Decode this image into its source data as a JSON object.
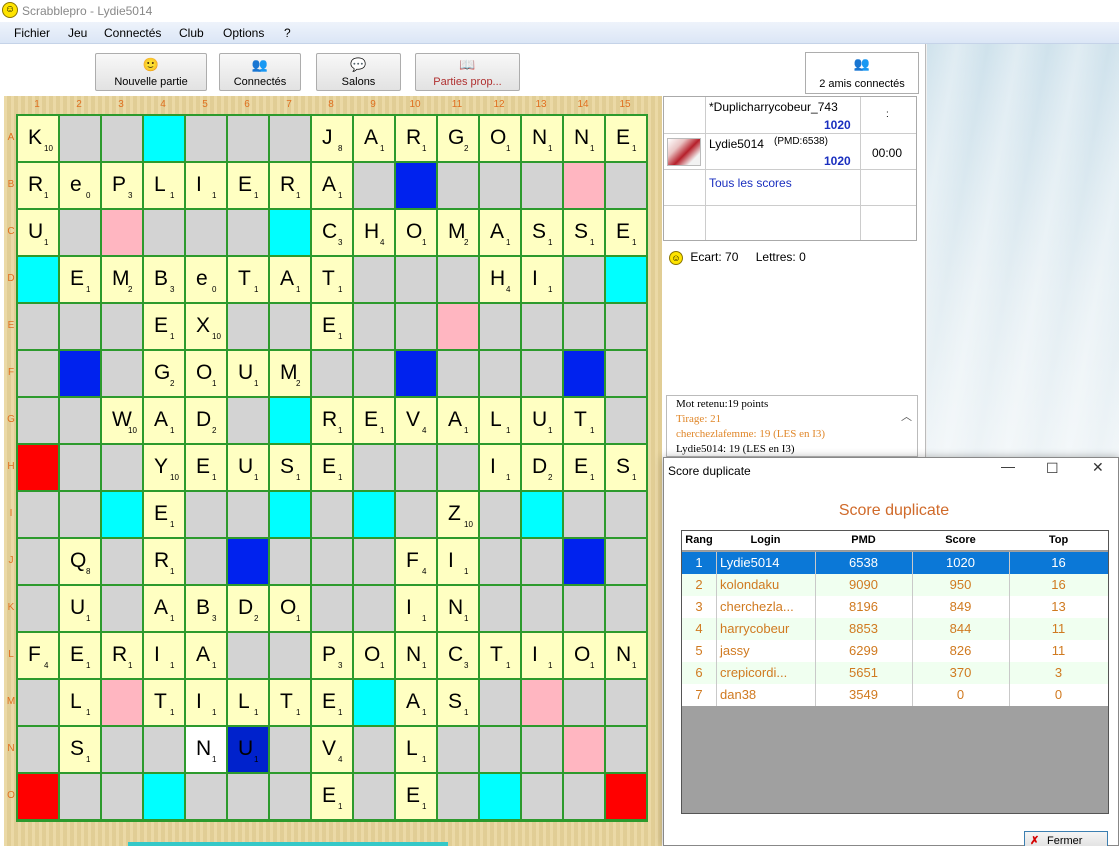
{
  "window": {
    "title": "Scrabblepro - Lydie5014"
  },
  "menu": [
    "Fichier",
    "Jeu",
    "Connectés",
    "Club",
    "Options",
    "?"
  ],
  "toolbar": {
    "new_game": "Nouvelle partie",
    "connected": "Connectés",
    "rooms": "Salons",
    "proposals": "Parties prop...",
    "friends": "2 amis connectés"
  },
  "board": {
    "columns": [
      "1",
      "2",
      "3",
      "4",
      "5",
      "6",
      "7",
      "8",
      "9",
      "10",
      "11",
      "12",
      "13",
      "14",
      "15"
    ],
    "rows": [
      "A",
      "B",
      "C",
      "D",
      "E",
      "F",
      "G",
      "H",
      "I",
      "J",
      "K",
      "L",
      "M",
      "N",
      "O"
    ],
    "tiles": [
      {
        "r": 0,
        "c": 0,
        "l": "K",
        "v": "10"
      },
      {
        "r": 0,
        "c": 7,
        "l": "J",
        "v": "8"
      },
      {
        "r": 0,
        "c": 8,
        "l": "A",
        "v": "1"
      },
      {
        "r": 0,
        "c": 9,
        "l": "R",
        "v": "1"
      },
      {
        "r": 0,
        "c": 10,
        "l": "G",
        "v": "2"
      },
      {
        "r": 0,
        "c": 11,
        "l": "O",
        "v": "1"
      },
      {
        "r": 0,
        "c": 12,
        "l": "N",
        "v": "1"
      },
      {
        "r": 0,
        "c": 13,
        "l": "N",
        "v": "1"
      },
      {
        "r": 0,
        "c": 14,
        "l": "E",
        "v": "1"
      },
      {
        "r": 1,
        "c": 0,
        "l": "R",
        "v": "1"
      },
      {
        "r": 1,
        "c": 1,
        "l": "e",
        "v": "0"
      },
      {
        "r": 1,
        "c": 2,
        "l": "P",
        "v": "3"
      },
      {
        "r": 1,
        "c": 3,
        "l": "L",
        "v": "1"
      },
      {
        "r": 1,
        "c": 4,
        "l": "I",
        "v": "1"
      },
      {
        "r": 1,
        "c": 5,
        "l": "E",
        "v": "1"
      },
      {
        "r": 1,
        "c": 6,
        "l": "R",
        "v": "1"
      },
      {
        "r": 1,
        "c": 7,
        "l": "A",
        "v": "1"
      },
      {
        "r": 2,
        "c": 0,
        "l": "U",
        "v": "1"
      },
      {
        "r": 2,
        "c": 7,
        "l": "C",
        "v": "3"
      },
      {
        "r": 2,
        "c": 8,
        "l": "H",
        "v": "4"
      },
      {
        "r": 2,
        "c": 9,
        "l": "O",
        "v": "1"
      },
      {
        "r": 2,
        "c": 10,
        "l": "M",
        "v": "2"
      },
      {
        "r": 2,
        "c": 11,
        "l": "A",
        "v": "1"
      },
      {
        "r": 2,
        "c": 12,
        "l": "S",
        "v": "1"
      },
      {
        "r": 2,
        "c": 13,
        "l": "S",
        "v": "1"
      },
      {
        "r": 2,
        "c": 14,
        "l": "E",
        "v": "1"
      },
      {
        "r": 3,
        "c": 1,
        "l": "E",
        "v": "1"
      },
      {
        "r": 3,
        "c": 2,
        "l": "M",
        "v": "2"
      },
      {
        "r": 3,
        "c": 3,
        "l": "B",
        "v": "3"
      },
      {
        "r": 3,
        "c": 4,
        "l": "e",
        "v": "0"
      },
      {
        "r": 3,
        "c": 5,
        "l": "T",
        "v": "1"
      },
      {
        "r": 3,
        "c": 6,
        "l": "A",
        "v": "1"
      },
      {
        "r": 3,
        "c": 7,
        "l": "T",
        "v": "1"
      },
      {
        "r": 3,
        "c": 11,
        "l": "H",
        "v": "4"
      },
      {
        "r": 3,
        "c": 12,
        "l": "I",
        "v": "1"
      },
      {
        "r": 4,
        "c": 3,
        "l": "E",
        "v": "1"
      },
      {
        "r": 4,
        "c": 4,
        "l": "X",
        "v": "10"
      },
      {
        "r": 4,
        "c": 7,
        "l": "E",
        "v": "1"
      },
      {
        "r": 5,
        "c": 3,
        "l": "G",
        "v": "2"
      },
      {
        "r": 5,
        "c": 4,
        "l": "O",
        "v": "1"
      },
      {
        "r": 5,
        "c": 5,
        "l": "U",
        "v": "1"
      },
      {
        "r": 5,
        "c": 6,
        "l": "M",
        "v": "2"
      },
      {
        "r": 6,
        "c": 2,
        "l": "W",
        "v": "10"
      },
      {
        "r": 6,
        "c": 3,
        "l": "A",
        "v": "1"
      },
      {
        "r": 6,
        "c": 4,
        "l": "D",
        "v": "2"
      },
      {
        "r": 6,
        "c": 7,
        "l": "R",
        "v": "1"
      },
      {
        "r": 6,
        "c": 8,
        "l": "E",
        "v": "1"
      },
      {
        "r": 6,
        "c": 9,
        "l": "V",
        "v": "4"
      },
      {
        "r": 6,
        "c": 10,
        "l": "A",
        "v": "1"
      },
      {
        "r": 6,
        "c": 11,
        "l": "L",
        "v": "1"
      },
      {
        "r": 6,
        "c": 12,
        "l": "U",
        "v": "1"
      },
      {
        "r": 6,
        "c": 13,
        "l": "T",
        "v": "1"
      },
      {
        "r": 7,
        "c": 3,
        "l": "Y",
        "v": "10"
      },
      {
        "r": 7,
        "c": 4,
        "l": "E",
        "v": "1"
      },
      {
        "r": 7,
        "c": 5,
        "l": "U",
        "v": "1"
      },
      {
        "r": 7,
        "c": 6,
        "l": "S",
        "v": "1"
      },
      {
        "r": 7,
        "c": 7,
        "l": "E",
        "v": "1"
      },
      {
        "r": 7,
        "c": 11,
        "l": "I",
        "v": "1"
      },
      {
        "r": 7,
        "c": 12,
        "l": "D",
        "v": "2"
      },
      {
        "r": 7,
        "c": 13,
        "l": "E",
        "v": "1"
      },
      {
        "r": 7,
        "c": 14,
        "l": "S",
        "v": "1"
      },
      {
        "r": 8,
        "c": 3,
        "l": "E",
        "v": "1"
      },
      {
        "r": 8,
        "c": 10,
        "l": "Z",
        "v": "10"
      },
      {
        "r": 9,
        "c": 1,
        "l": "Q",
        "v": "8"
      },
      {
        "r": 9,
        "c": 3,
        "l": "R",
        "v": "1"
      },
      {
        "r": 9,
        "c": 9,
        "l": "F",
        "v": "4"
      },
      {
        "r": 9,
        "c": 10,
        "l": "I",
        "v": "1"
      },
      {
        "r": 10,
        "c": 1,
        "l": "U",
        "v": "1"
      },
      {
        "r": 10,
        "c": 3,
        "l": "A",
        "v": "1"
      },
      {
        "r": 10,
        "c": 4,
        "l": "B",
        "v": "3"
      },
      {
        "r": 10,
        "c": 5,
        "l": "D",
        "v": "2"
      },
      {
        "r": 10,
        "c": 6,
        "l": "O",
        "v": "1"
      },
      {
        "r": 10,
        "c": 9,
        "l": "I",
        "v": "1"
      },
      {
        "r": 10,
        "c": 10,
        "l": "N",
        "v": "1"
      },
      {
        "r": 11,
        "c": 0,
        "l": "F",
        "v": "4"
      },
      {
        "r": 11,
        "c": 1,
        "l": "E",
        "v": "1"
      },
      {
        "r": 11,
        "c": 2,
        "l": "R",
        "v": "1"
      },
      {
        "r": 11,
        "c": 3,
        "l": "I",
        "v": "1"
      },
      {
        "r": 11,
        "c": 4,
        "l": "A",
        "v": "1"
      },
      {
        "r": 11,
        "c": 7,
        "l": "P",
        "v": "3"
      },
      {
        "r": 11,
        "c": 8,
        "l": "O",
        "v": "1"
      },
      {
        "r": 11,
        "c": 9,
        "l": "N",
        "v": "1"
      },
      {
        "r": 11,
        "c": 10,
        "l": "C",
        "v": "3"
      },
      {
        "r": 11,
        "c": 11,
        "l": "T",
        "v": "1"
      },
      {
        "r": 11,
        "c": 12,
        "l": "I",
        "v": "1"
      },
      {
        "r": 11,
        "c": 13,
        "l": "O",
        "v": "1"
      },
      {
        "r": 11,
        "c": 14,
        "l": "N",
        "v": "1"
      },
      {
        "r": 12,
        "c": 1,
        "l": "L",
        "v": "1"
      },
      {
        "r": 12,
        "c": 3,
        "l": "T",
        "v": "1"
      },
      {
        "r": 12,
        "c": 4,
        "l": "I",
        "v": "1"
      },
      {
        "r": 12,
        "c": 5,
        "l": "L",
        "v": "1"
      },
      {
        "r": 12,
        "c": 6,
        "l": "T",
        "v": "1"
      },
      {
        "r": 12,
        "c": 7,
        "l": "E",
        "v": "1"
      },
      {
        "r": 12,
        "c": 9,
        "l": "A",
        "v": "1"
      },
      {
        "r": 12,
        "c": 10,
        "l": "S",
        "v": "1"
      },
      {
        "r": 13,
        "c": 1,
        "l": "S",
        "v": "1"
      },
      {
        "r": 13,
        "c": 4,
        "l": "N",
        "v": "1",
        "style": "new"
      },
      {
        "r": 13,
        "c": 5,
        "l": "U",
        "v": "1",
        "style": "blue"
      },
      {
        "r": 13,
        "c": 7,
        "l": "V",
        "v": "4"
      },
      {
        "r": 13,
        "c": 9,
        "l": "L",
        "v": "1"
      },
      {
        "r": 14,
        "c": 7,
        "l": "E",
        "v": "1"
      },
      {
        "r": 14,
        "c": 9,
        "l": "E",
        "v": "1"
      }
    ],
    "premiums": {
      "tw": [
        [
          7,
          0
        ],
        [
          14,
          0
        ],
        [
          14,
          14
        ]
      ],
      "dw": [
        [
          1,
          13
        ],
        [
          2,
          2
        ],
        [
          4,
          10
        ],
        [
          12,
          2
        ],
        [
          12,
          12
        ],
        [
          13,
          13
        ]
      ],
      "tl": [
        [
          1,
          9
        ],
        [
          5,
          1
        ],
        [
          5,
          9
        ],
        [
          5,
          13
        ],
        [
          9,
          5
        ],
        [
          9,
          13
        ]
      ],
      "dl": [
        [
          0,
          3
        ],
        [
          2,
          6
        ],
        [
          3,
          0
        ],
        [
          3,
          14
        ],
        [
          6,
          6
        ],
        [
          8,
          2
        ],
        [
          8,
          6
        ],
        [
          8,
          8
        ],
        [
          8,
          12
        ],
        [
          12,
          8
        ],
        [
          14,
          3
        ],
        [
          14,
          11
        ]
      ]
    }
  },
  "players": {
    "row1_name": "*Duplicharrycobeur_743",
    "row1_score": "1020",
    "row1_extra": ":",
    "row2_name": "Lydie5014",
    "row2_pmd": "(PMD:6538)",
    "row2_score": "1020",
    "row2_time": "00:00",
    "all_scores": "Tous les scores"
  },
  "status": {
    "ecart": "Ecart: 70",
    "lettres": "Lettres: 0"
  },
  "log": [
    {
      "text": "Mot retenu:19 points",
      "color": "#000000"
    },
    {
      "text": "Tirage: 21",
      "color": "#e0872a"
    },
    {
      "text": "cherchezlafemme: 19 (LES en I3)",
      "color": "#e0872a"
    },
    {
      "text": "Lydie5014: 19 (LES en I3)",
      "color": "#000000"
    }
  ],
  "dialog": {
    "title": "Score duplicate",
    "heading": "Score duplicate",
    "columns": [
      "Rang",
      "Login",
      "PMD",
      "Score",
      "Top"
    ],
    "rows": [
      [
        "1",
        "Lydie5014",
        "6538",
        "1020",
        "16"
      ],
      [
        "2",
        "kolondaku",
        "9090",
        "950",
        "16"
      ],
      [
        "3",
        "cherchezla...",
        "8196",
        "849",
        "13"
      ],
      [
        "4",
        "harrycobeur",
        "8853",
        "844",
        "11"
      ],
      [
        "5",
        "jassy",
        "6299",
        "826",
        "11"
      ],
      [
        "6",
        "crepicordi...",
        "5651",
        "370",
        "3"
      ],
      [
        "7",
        "dan38",
        "3549",
        "0",
        "0"
      ]
    ],
    "close_label": "Fermer"
  },
  "colors": {
    "triple_word": "#ff0000",
    "double_word": "#ffb6c1",
    "triple_letter": "#0022ee",
    "double_letter": "#00ffff",
    "tile": "#ffffc2",
    "label_orange": "#e07020",
    "selected_row": "#0b78d7"
  }
}
